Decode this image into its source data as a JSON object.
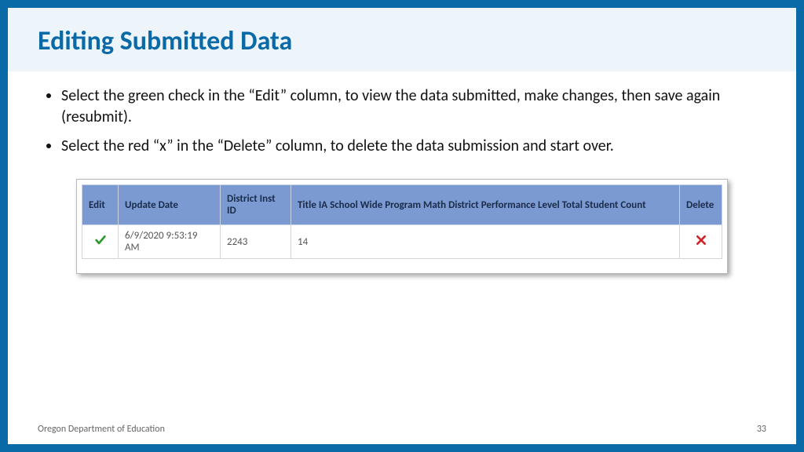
{
  "title": "Editing Submitted Data",
  "bullets": [
    "Select the green check in the “Edit” column, to view the data submitted, make changes, then save again (resubmit).",
    "Select the red “x” in the “Delete” column, to delete the data submission and start over."
  ],
  "table": {
    "headers": {
      "edit": "Edit",
      "update_date": "Update Date",
      "district_inst_id": "District Inst ID",
      "count": "Title IA School Wide Program Math District Performance Level Total Student Count",
      "delete": "Delete"
    },
    "rows": [
      {
        "update_date": "6/9/2020 9:53:19 AM",
        "district_inst_id": "2243",
        "count": "14"
      }
    ]
  },
  "footer": {
    "org": "Oregon Department of Education",
    "page": "33"
  }
}
